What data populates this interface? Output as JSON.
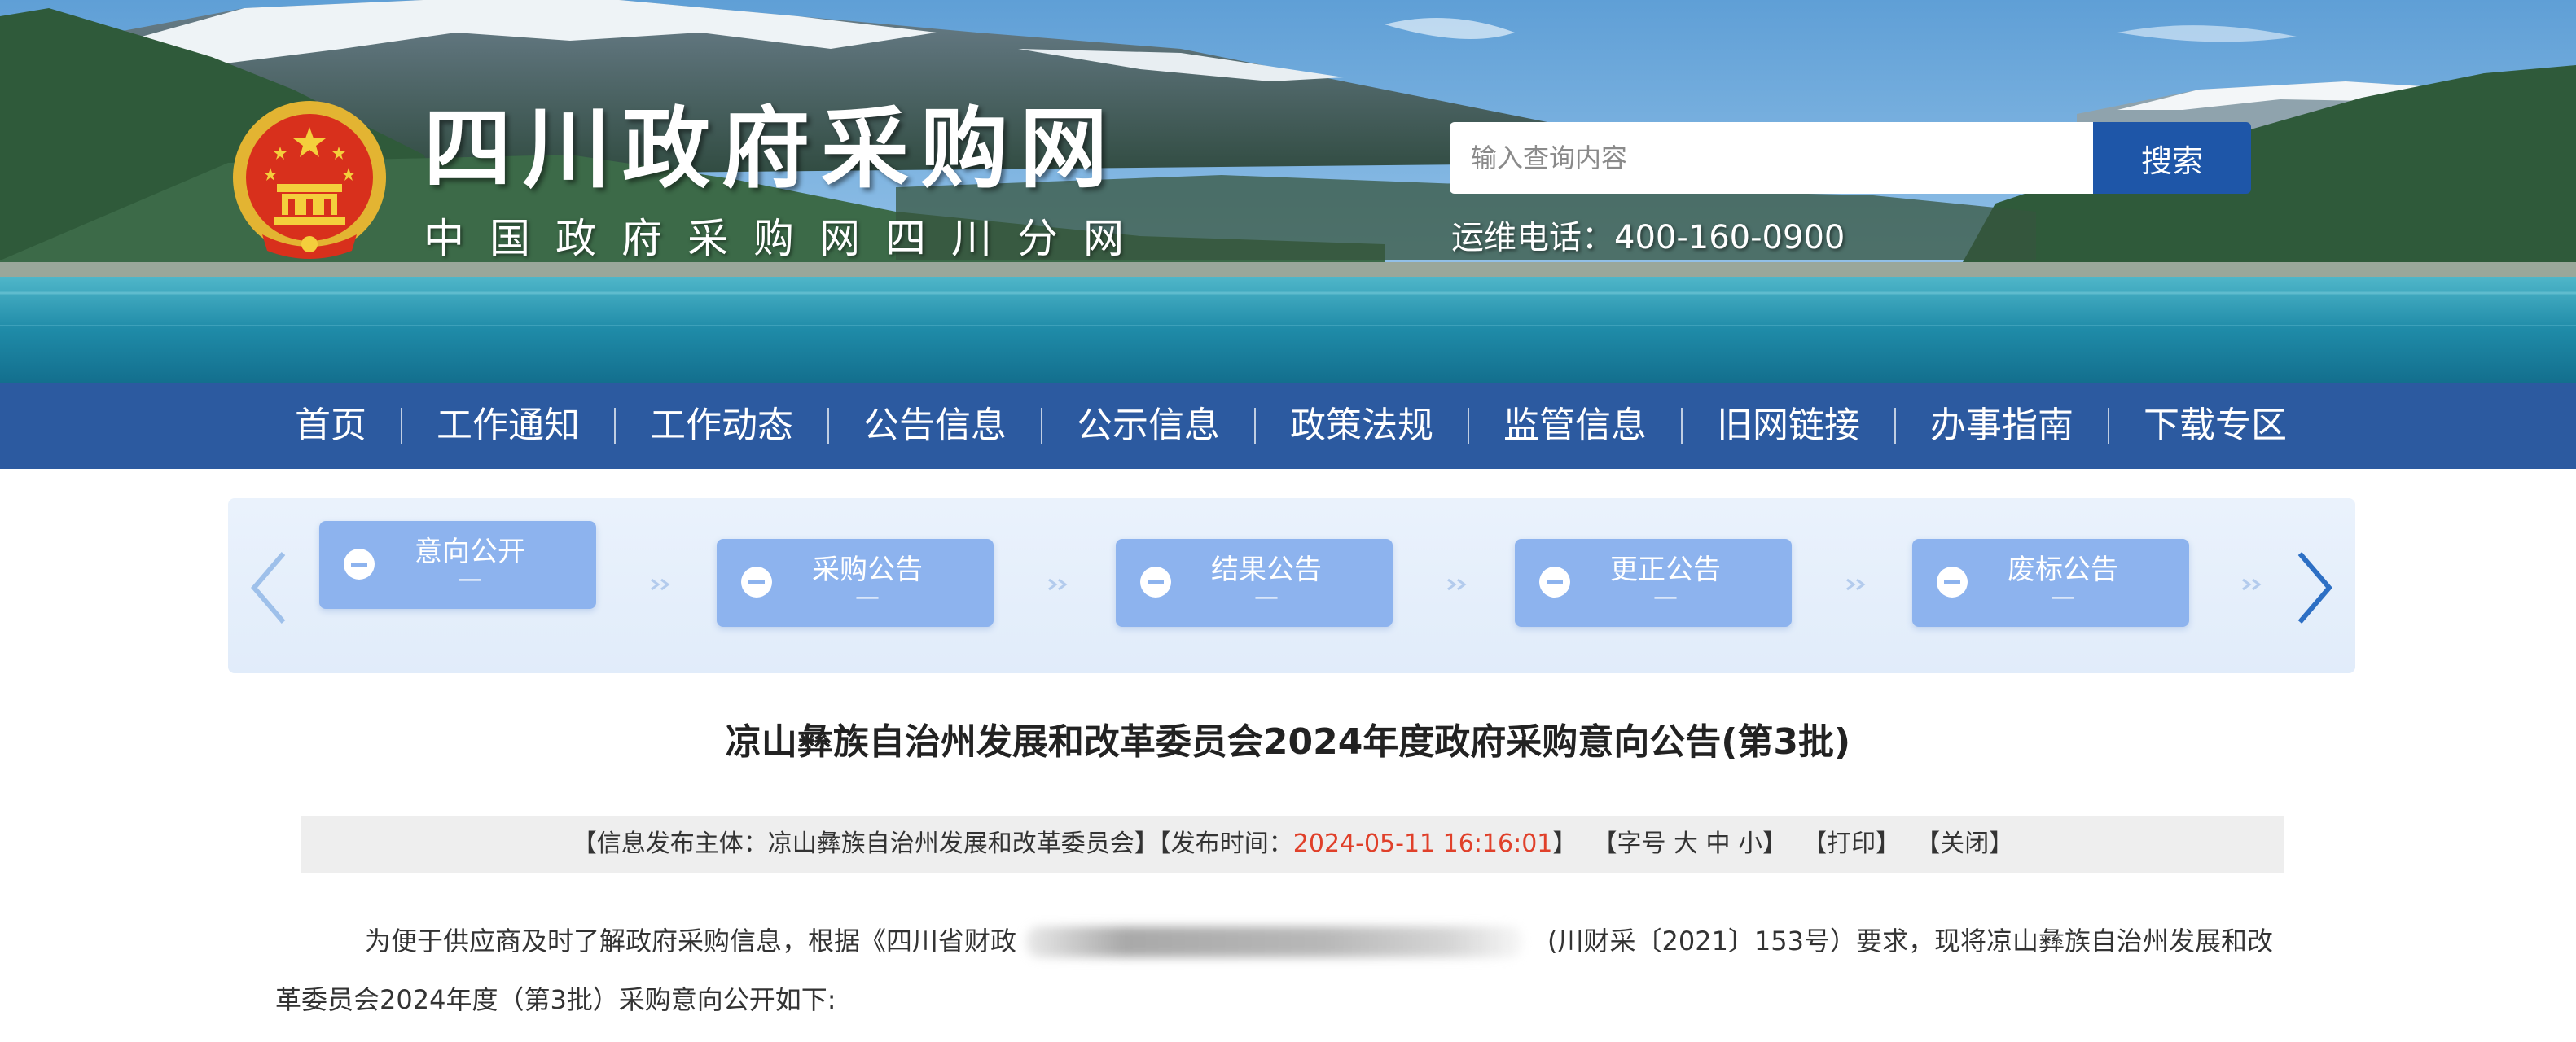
{
  "header": {
    "site_title": "四川政府采购网",
    "site_subtitle": "中国政府采购网四川分网",
    "search_placeholder": "输入查询内容",
    "search_button": "搜索",
    "hotline": "运维电话：400-160-0900"
  },
  "nav": {
    "items": [
      "首页",
      "工作通知",
      "工作动态",
      "公告信息",
      "公示信息",
      "政策法规",
      "监管信息",
      "旧网链接",
      "办事指南",
      "下载专区"
    ]
  },
  "categories": [
    {
      "label": "意向公开",
      "sub": "—"
    },
    {
      "label": "采购公告",
      "sub": "—"
    },
    {
      "label": "结果公告",
      "sub": "—"
    },
    {
      "label": "更正公告",
      "sub": "—"
    },
    {
      "label": "废标公告",
      "sub": "—"
    }
  ],
  "article": {
    "title": "凉山彝族自治州发展和改革委员会2024年度政府采购意向公告(第3批)",
    "meta": {
      "publisher_prefix": "【信息发布主体：凉山彝族自治州发展和改革委员会】【发布时间：",
      "date": "2024-05-11 16:16:01",
      "date_suffix": "】",
      "font_size": "【字号 大 中 小】",
      "print": "【打印】",
      "close": "【关闭】"
    },
    "para1_start": "为便于供应商及时了解政府采购信息，根据《四川省财政",
    "para1_end": "(川财采〔2021〕153号）要求，现将凉山彝族自治州发展和改",
    "para2": "革委员会2024年度（第3批）采购意向公开如下:"
  },
  "colors": {
    "nav_bg": "#2c5aa0",
    "search_btn": "#1e56a8",
    "category_btn": "#8db3ee",
    "date_red": "#e0402a"
  }
}
